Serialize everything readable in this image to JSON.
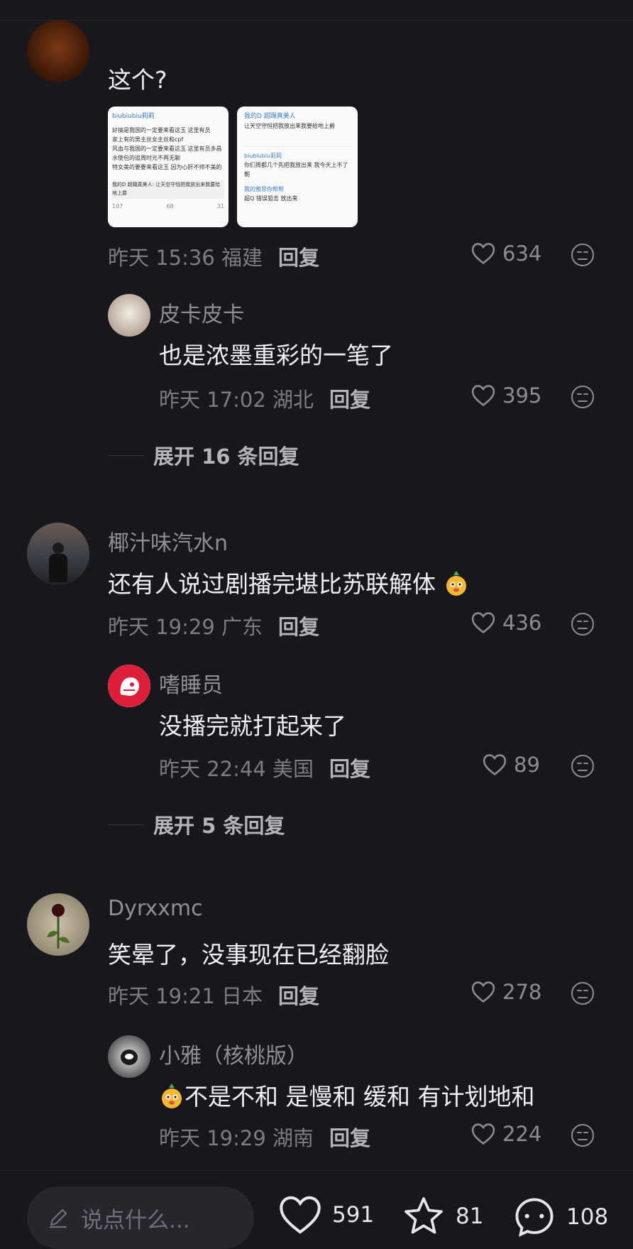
{
  "comments": [
    {
      "username": "",
      "text": "这个?",
      "images": [
        {
          "user": "biubiubiu莉莉",
          "lines": [
            "好搞是我国的一定要来看这玉 这里有员",
            "家上有的男主丝女主丝和cpf",
            "风血与我国的一定要来看这玉 这里有员多昌",
            "水使包的追周时光不再无聊",
            "特女美的要要来看这玉 因为心肝不帅不美的"
          ],
          "footer": "我的D 超蹋真美人: 让天空守恒把我放出来我要给地上爵",
          "stats": [
            "107",
            "68",
            "31"
          ]
        },
        {
          "user": "我的D 超蹋真美人",
          "lines": [
            "让天空守恒把我放出来我要给地上爵",
            "biubiubiu莉莉",
            "你们周都几个先把我放出来 我今天上不了朝",
            "我的雅思你帮帮",
            "超Q 错误狙击 放出来"
          ],
          "footer": "",
          "stats": []
        }
      ],
      "time": "昨天 15:36 福建",
      "reply": "回复",
      "likes": "634"
    },
    {
      "username": "皮卡皮卡",
      "text": "也是浓墨重彩的一笔了",
      "time": "昨天 17:02 湖北",
      "reply": "回复",
      "likes": "395"
    },
    {
      "username": "椰汁味汽水n",
      "text": "还有人说过剧播完堪比苏联解体",
      "time": "昨天 19:29 广东",
      "reply": "回复",
      "likes": "436"
    },
    {
      "username": "嗜睡员",
      "text": "没播完就打起来了",
      "time": "昨天 22:44 美国",
      "reply": "回复",
      "likes": "89"
    },
    {
      "username": "Dyrxxmc",
      "text": "笑晕了，没事现在已经翻脸",
      "time": "昨天 19:21 日本",
      "reply": "回复",
      "likes": "278"
    },
    {
      "username": "小雅（核桃版）",
      "text": "不是不和 是慢和 缓和 有计划地和",
      "time": "昨天 19:29 湖南",
      "reply": "回复",
      "likes": "224"
    }
  ],
  "expands": [
    "展开 16 条回复",
    "展开 5 条回复"
  ],
  "bottom": {
    "placeholder": "说点什么...",
    "likes": "591",
    "stars": "81",
    "comments": "108"
  },
  "colors": {
    "background": "#17171c",
    "text_secondary": "#8f8f98",
    "reply": "#b4b4bb"
  }
}
